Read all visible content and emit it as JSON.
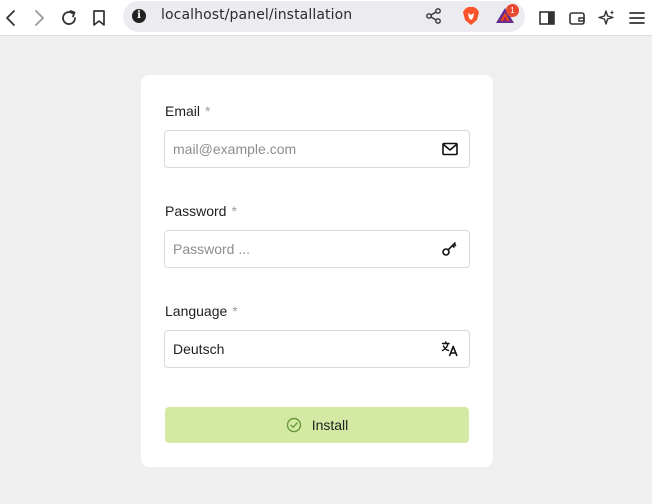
{
  "browser": {
    "url": "localhost/panel/installation",
    "badge_count": "1"
  },
  "form": {
    "email": {
      "label": "Email",
      "required_mark": "*",
      "placeholder": "mail@example.com",
      "icon": "mail-icon"
    },
    "password": {
      "label": "Password",
      "required_mark": "*",
      "placeholder": "Password ...",
      "icon": "key-icon"
    },
    "language": {
      "label": "Language",
      "required_mark": "*",
      "value": "Deutsch",
      "icon": "translate-icon"
    },
    "submit_label": "Install"
  },
  "colors": {
    "page_bg": "#efefef",
    "card_bg": "#ffffff",
    "install_button": "#d3e9a4",
    "install_icon": "#6a9a3a"
  }
}
